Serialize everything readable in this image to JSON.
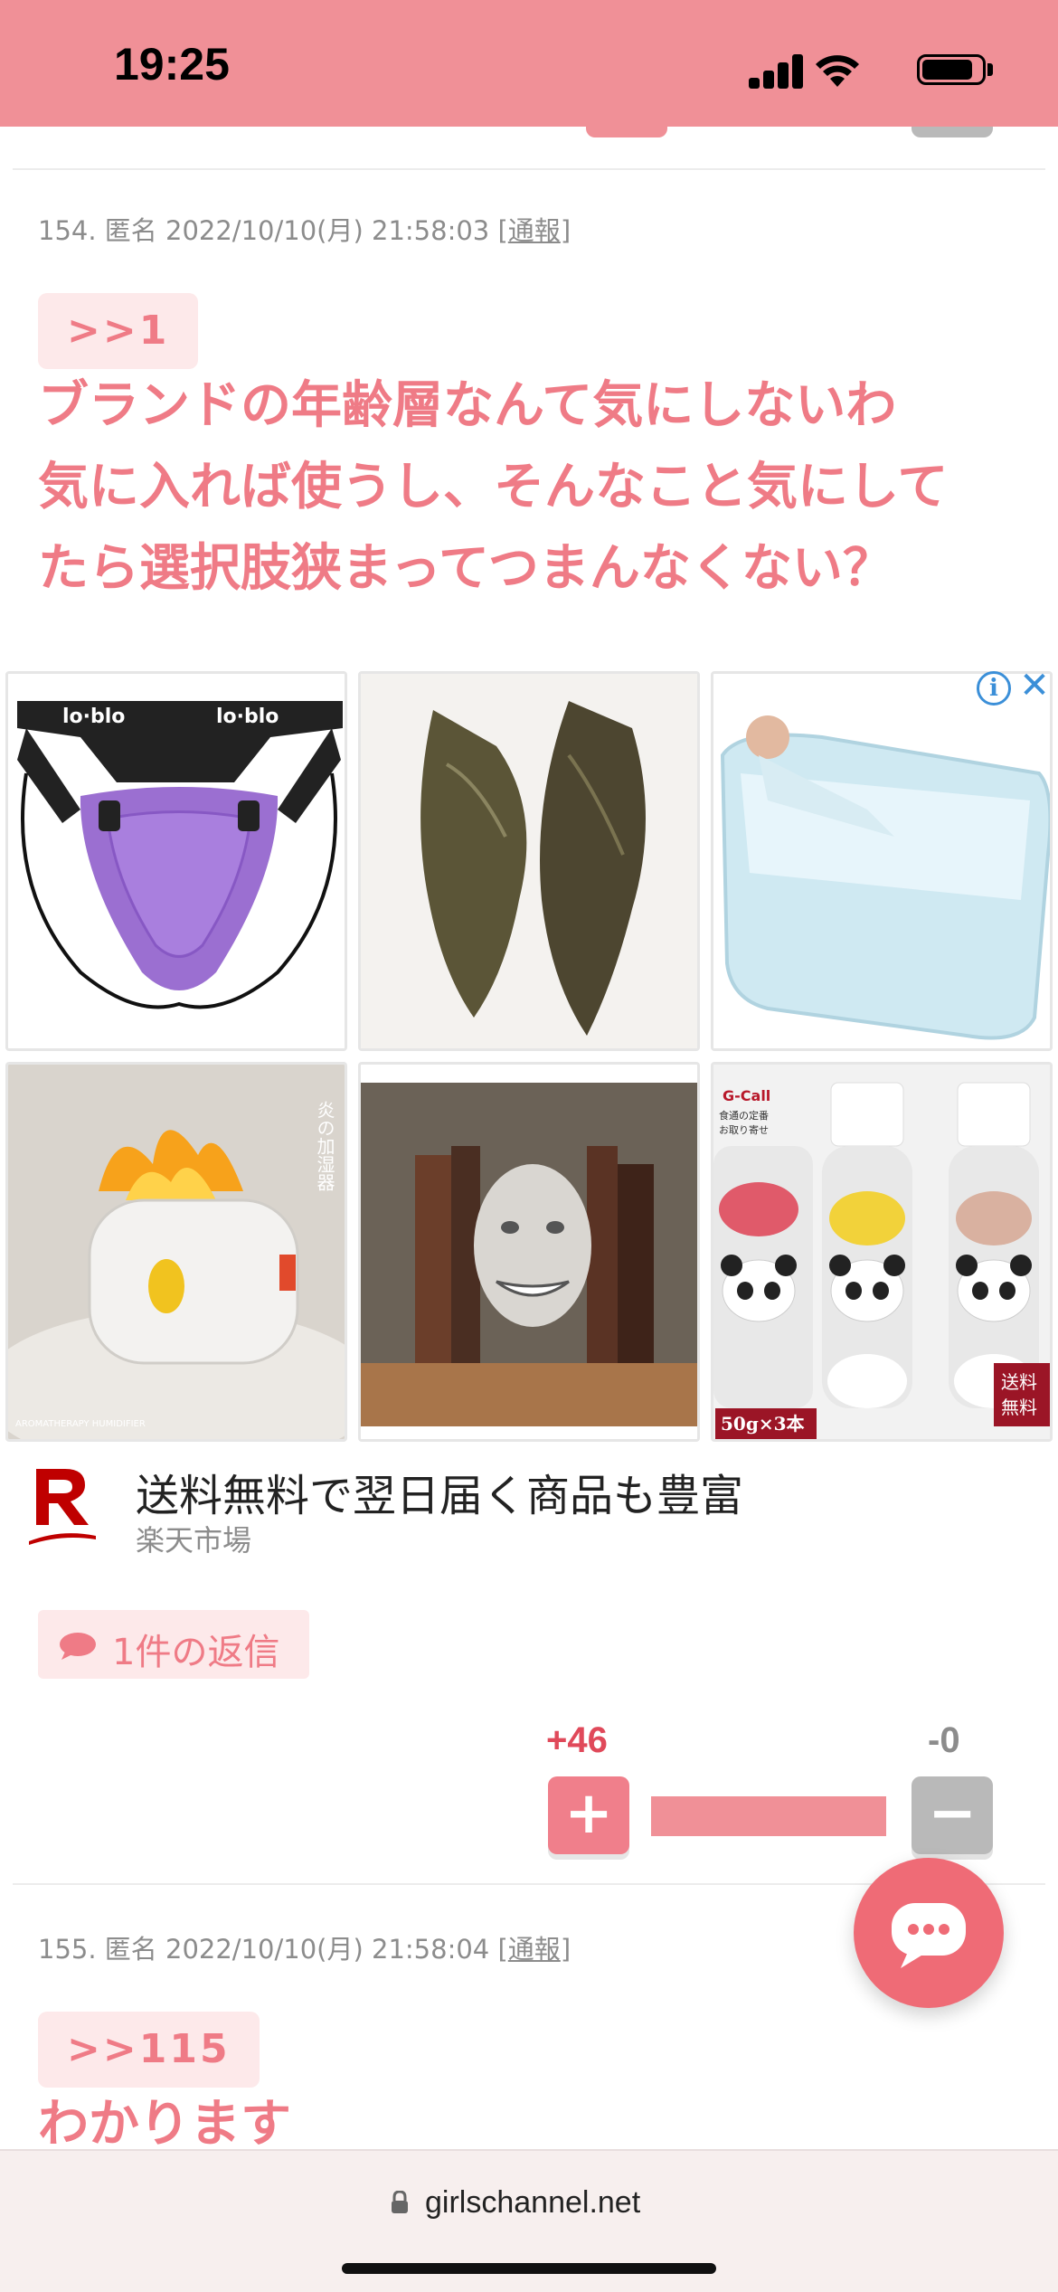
{
  "status_bar": {
    "time": "19:25"
  },
  "comments": [
    {
      "meta": "154. 匿名 2022/10/10(月) 21:58:03",
      "report_label": "通報",
      "anchor": ">>1",
      "body_lines": [
        "ブランドの年齢層なんて気にしないわ",
        "気に入れば使うし、そんなこと気にして",
        "たら選択肢狭まってつまんなくない？"
      ],
      "reply_label": "1件の返信",
      "plus_count": "+46",
      "minus_count": "-0",
      "plus_symbol": "+",
      "minus_symbol": "−",
      "plus_ratio": 1.0
    },
    {
      "meta": "155. 匿名 2022/10/10(月) 21:58:04",
      "report_label": "通報",
      "anchor": ">>115",
      "body_lines": [
        "わかります"
      ]
    }
  ],
  "ad": {
    "title": "送料無料で翌日届く商品も豊富",
    "source": "楽天市場",
    "info_glyph": "i",
    "close_glyph": "✕",
    "images": [
      {
        "name": "ad-image-purple-guard",
        "text": [
          "lo·blo",
          "lo·blo"
        ]
      },
      {
        "name": "ad-image-water-bugs",
        "text": []
      },
      {
        "name": "ad-image-bathtub",
        "text": []
      },
      {
        "name": "ad-image-flame-humidifier",
        "text": [
          "炎の加湿器",
          "AROMATHERAPY HUMIDIFIER"
        ]
      },
      {
        "name": "ad-image-face-bookend",
        "text": []
      },
      {
        "name": "ad-image-panda-salt",
        "text": [
          "G-Call",
          "食通の定番",
          "お取り寄せ",
          "送料",
          "無料",
          "50g×3本"
        ]
      }
    ]
  },
  "url_bar": {
    "domain": "girlschannel.net"
  },
  "colors": {
    "accent": "#ef7b86",
    "status_bar": "#f09097",
    "fab": "#ef6b76"
  }
}
